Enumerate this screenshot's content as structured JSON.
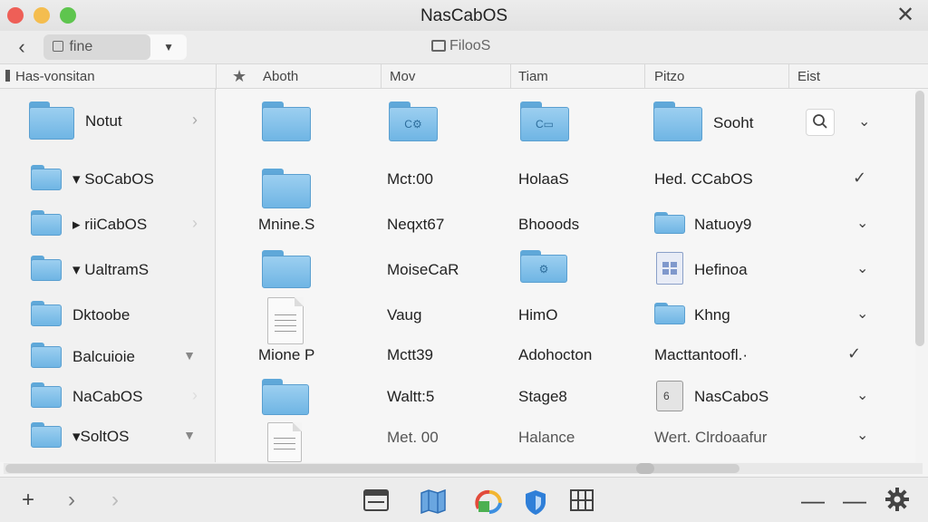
{
  "window": {
    "title": "NasCabOS"
  },
  "toolbar": {
    "path_label": "fine",
    "center_label": "FilooS"
  },
  "columns": [
    "Aboth",
    "Mov",
    "Tiam",
    "Pitzo",
    "Eist"
  ],
  "sidebar": {
    "header": "Has-vonsitan",
    "items": [
      {
        "label": "Notut"
      },
      {
        "label": "SoCabOS"
      },
      {
        "label": "riiCabOS"
      },
      {
        "label": "UaltramS"
      },
      {
        "label": "Dktoobe"
      },
      {
        "label": "Balcuioie"
      },
      {
        "label": "NaCabOS"
      },
      {
        "label": "SoltOS"
      }
    ]
  },
  "rows": [
    {
      "c1": "",
      "c2": "",
      "c3": "",
      "c4": "Sooht"
    },
    {
      "c1": "",
      "c2": "Mct:00",
      "c3": "HolaaS",
      "c4": "Hed. CCabOS"
    },
    {
      "c1": "Mnine.S",
      "c2": "Neqxt67",
      "c3": "Bhooods",
      "c4": "Natuoy9"
    },
    {
      "c1": "",
      "c2": "MoiseCaR",
      "c3": "",
      "c4": "Hefinoa"
    },
    {
      "c1": "",
      "c2": "Vaug",
      "c3": "HimO",
      "c4": "Khng"
    },
    {
      "c1": "Mione P",
      "c2": "Mctt39",
      "c3": "Adohocton",
      "c4": "Macttantoofl.·"
    },
    {
      "c1": "",
      "c2": "Waltt:5",
      "c3": "Stage8",
      "c4": "NasCaboS"
    },
    {
      "c1": "",
      "c2": "Met. 00",
      "c3": "Halance",
      "c4": "Wert. Clrdoaafur"
    }
  ],
  "icons": {
    "row1": [
      "folder-icon",
      "folder-c-icon",
      "folder-c-icon",
      "folder-icon"
    ],
    "accent": "#6fb5e4"
  }
}
